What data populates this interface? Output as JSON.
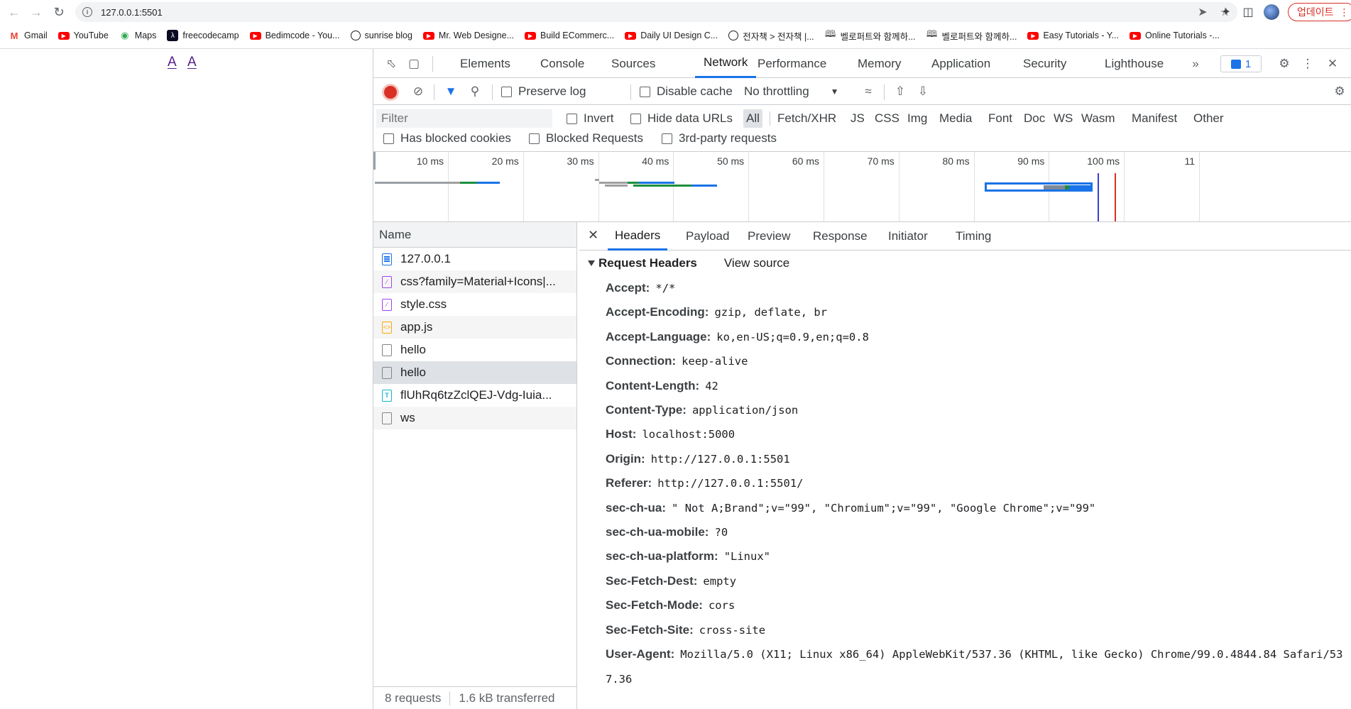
{
  "browser": {
    "url": "127.0.0.1:5501",
    "update_label": "업데이트",
    "bookmarks": [
      {
        "label": "Gmail",
        "icon": "gmail-icon"
      },
      {
        "label": "YouTube",
        "icon": "youtube-icon"
      },
      {
        "label": "Maps",
        "icon": "maps-icon"
      },
      {
        "label": "freecodecamp",
        "icon": "freecodecamp-icon"
      },
      {
        "label": "Bedimcode - You...",
        "icon": "youtube-icon"
      },
      {
        "label": "sunrise blog",
        "icon": "globe-icon"
      },
      {
        "label": "Mr. Web Designe...",
        "icon": "youtube-icon"
      },
      {
        "label": "Build ECommerc...",
        "icon": "youtube-icon"
      },
      {
        "label": "Daily UI Design C...",
        "icon": "youtube-icon"
      },
      {
        "label": "전자책 > 전자책 |...",
        "icon": "globe-icon"
      },
      {
        "label": "벨로퍼트와 함께하...",
        "icon": "book-icon"
      },
      {
        "label": "벨로퍼트와 함께하...",
        "icon": "book-icon"
      },
      {
        "label": "Easy Tutorials - Y...",
        "icon": "youtube-icon"
      },
      {
        "label": "Online Tutorials -...",
        "icon": "youtube-icon"
      }
    ]
  },
  "page": {
    "links": [
      "A",
      "A"
    ]
  },
  "devtools": {
    "tabs": [
      "Elements",
      "Console",
      "Sources",
      "Network",
      "Performance",
      "Memory",
      "Application",
      "Security",
      "Lighthouse"
    ],
    "active_tab": "Network",
    "issues_count": "1",
    "toolbar": {
      "preserve_log": "Preserve log",
      "disable_cache": "Disable cache",
      "throttling": "No throttling"
    },
    "filter": {
      "placeholder": "Filter",
      "invert": "Invert",
      "hide_data_urls": "Hide data URLs",
      "types": [
        "All",
        "Fetch/XHR",
        "JS",
        "CSS",
        "Img",
        "Media",
        "Font",
        "Doc",
        "WS",
        "Wasm",
        "Manifest",
        "Other"
      ],
      "has_blocked_cookies": "Has blocked cookies",
      "blocked_requests": "Blocked Requests",
      "third_party": "3rd-party requests"
    },
    "timeline_ticks": [
      "10 ms",
      "20 ms",
      "30 ms",
      "40 ms",
      "50 ms",
      "60 ms",
      "70 ms",
      "80 ms",
      "90 ms",
      "100 ms",
      "11"
    ],
    "request_list": {
      "header": "Name",
      "rows": [
        {
          "name": "127.0.0.1",
          "type": "doc"
        },
        {
          "name": "css?family=Material+Icons|...",
          "type": "css"
        },
        {
          "name": "style.css",
          "type": "css"
        },
        {
          "name": "app.js",
          "type": "js"
        },
        {
          "name": "hello",
          "type": "plain"
        },
        {
          "name": "hello",
          "type": "plain"
        },
        {
          "name": "flUhRq6tzZclQEJ-Vdg-Iuia...",
          "type": "font"
        },
        {
          "name": "ws",
          "type": "plain"
        }
      ],
      "status_requests": "8 requests",
      "status_transferred": "1.6 kB transferred"
    },
    "detail": {
      "tabs": [
        "Headers",
        "Payload",
        "Preview",
        "Response",
        "Initiator",
        "Timing"
      ],
      "active_tab": "Headers",
      "section_title": "Request Headers",
      "view_source": "View source",
      "headers": [
        {
          "key": "Accept:",
          "value": "*/*"
        },
        {
          "key": "Accept-Encoding:",
          "value": "gzip, deflate, br"
        },
        {
          "key": "Accept-Language:",
          "value": "ko,en-US;q=0.9,en;q=0.8"
        },
        {
          "key": "Connection:",
          "value": "keep-alive"
        },
        {
          "key": "Content-Length:",
          "value": "42"
        },
        {
          "key": "Content-Type:",
          "value": "application/json"
        },
        {
          "key": "Host:",
          "value": "localhost:5000"
        },
        {
          "key": "Origin:",
          "value": "http://127.0.0.1:5501"
        },
        {
          "key": "Referer:",
          "value": "http://127.0.0.1:5501/"
        },
        {
          "key": "sec-ch-ua:",
          "value": "\" Not A;Brand\";v=\"99\", \"Chromium\";v=\"99\", \"Google Chrome\";v=\"99\""
        },
        {
          "key": "sec-ch-ua-mobile:",
          "value": "?0"
        },
        {
          "key": "sec-ch-ua-platform:",
          "value": "\"Linux\""
        },
        {
          "key": "Sec-Fetch-Dest:",
          "value": "empty"
        },
        {
          "key": "Sec-Fetch-Mode:",
          "value": "cors"
        },
        {
          "key": "Sec-Fetch-Site:",
          "value": "cross-site"
        },
        {
          "key": "User-Agent:",
          "value": "Mozilla/5.0 (X11; Linux x86_64) AppleWebKit/537.36 (KHTML, like Gecko) Chrome/99.0.4844.84 Safari/537.36"
        }
      ]
    },
    "colors": {
      "accent": "#1a73e8",
      "record": "#d93025",
      "link": "#551a8b"
    }
  }
}
